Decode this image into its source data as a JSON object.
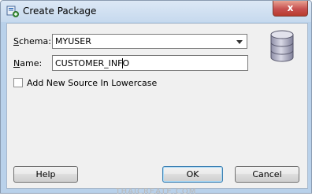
{
  "window": {
    "title": "Create Package",
    "close_label": "x"
  },
  "form": {
    "schema_label": "Schema:",
    "schema_value": "MYUSER",
    "name_label": "Name:",
    "name_value": "CUSTOMER_INFO",
    "lowercase_label": "Add New Source In Lowercase",
    "lowercase_checked": false
  },
  "buttons": {
    "help": "Help",
    "ok": "OK",
    "cancel": "Cancel"
  },
  "watermark": "THAICREATE.COM",
  "icons": {
    "app": "package-icon",
    "database": "database-icon"
  },
  "colors": {
    "titlebar": "#c6d9ee",
    "close": "#c75050",
    "client": "#f0f0f0"
  }
}
